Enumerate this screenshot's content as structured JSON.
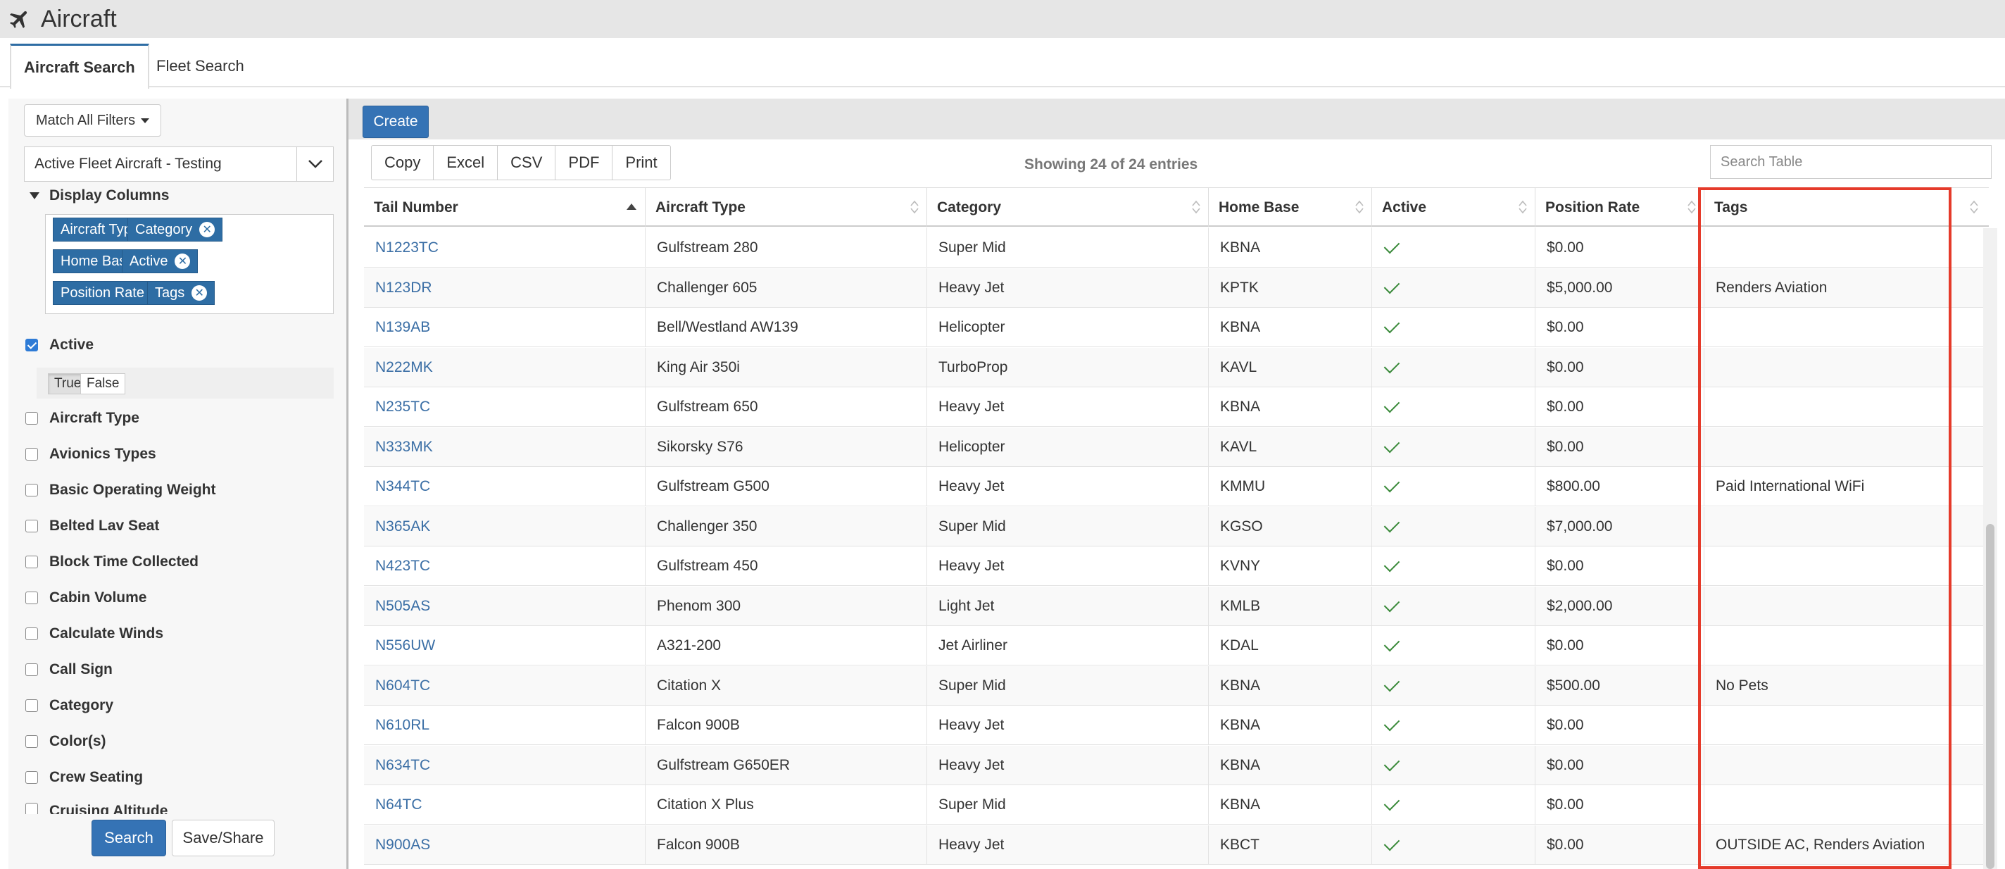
{
  "app": {
    "title": "Aircraft",
    "title_icon": "airplane-icon"
  },
  "tabs": [
    {
      "label": "Aircraft Search",
      "active": true
    },
    {
      "label": "Fleet Search",
      "active": false
    }
  ],
  "filters": {
    "match_label": "Match All Filters",
    "saved_search": "Active Fleet Aircraft - Testing",
    "display_columns_label": "Display Columns",
    "display_columns": [
      "Aircraft Type",
      "Category",
      "Home Base",
      "Active",
      "Position Rate",
      "Tags"
    ],
    "active_label": "Active",
    "active_checked": true,
    "bool_true": "True",
    "bool_false": "False",
    "options": [
      "Aircraft Type",
      "Avionics Types",
      "Basic Operating Weight",
      "Belted Lav Seat",
      "Block Time Collected",
      "Cabin Volume",
      "Calculate Winds",
      "Call Sign",
      "Category",
      "Color(s)",
      "Crew Seating",
      "Cruising Altitude"
    ],
    "search_label": "Search",
    "save_label": "Save/Share"
  },
  "main": {
    "create_label": "Create",
    "export_buttons": [
      "Copy",
      "Excel",
      "CSV",
      "PDF",
      "Print"
    ],
    "showing_text": "Showing 24 of 24 entries",
    "search_placeholder": "Search Table"
  },
  "table": {
    "headers": [
      "Tail Number",
      "Aircraft Type",
      "Category",
      "Home Base",
      "Active",
      "Position Rate",
      "Tags"
    ],
    "rows": [
      {
        "tail": "N1223TC",
        "type": "Gulfstream 280",
        "category": "Super Mid",
        "base": "KBNA",
        "active": true,
        "rate": "$0.00",
        "tags": ""
      },
      {
        "tail": "N123DR",
        "type": "Challenger 605",
        "category": "Heavy Jet",
        "base": "KPTK",
        "active": true,
        "rate": "$5,000.00",
        "tags": "Renders Aviation"
      },
      {
        "tail": "N139AB",
        "type": "Bell/Westland AW139",
        "category": "Helicopter",
        "base": "KBNA",
        "active": true,
        "rate": "$0.00",
        "tags": ""
      },
      {
        "tail": "N222MK",
        "type": "King Air 350i",
        "category": "TurboProp",
        "base": "KAVL",
        "active": true,
        "rate": "$0.00",
        "tags": ""
      },
      {
        "tail": "N235TC",
        "type": "Gulfstream 650",
        "category": "Heavy Jet",
        "base": "KBNA",
        "active": true,
        "rate": "$0.00",
        "tags": ""
      },
      {
        "tail": "N333MK",
        "type": "Sikorsky S76",
        "category": "Helicopter",
        "base": "KAVL",
        "active": true,
        "rate": "$0.00",
        "tags": ""
      },
      {
        "tail": "N344TC",
        "type": "Gulfstream G500",
        "category": "Heavy Jet",
        "base": "KMMU",
        "active": true,
        "rate": "$800.00",
        "tags": "Paid International WiFi"
      },
      {
        "tail": "N365AK",
        "type": "Challenger 350",
        "category": "Super Mid",
        "base": "KGSO",
        "active": true,
        "rate": "$7,000.00",
        "tags": ""
      },
      {
        "tail": "N423TC",
        "type": "Gulfstream 450",
        "category": "Heavy Jet",
        "base": "KVNY",
        "active": true,
        "rate": "$0.00",
        "tags": ""
      },
      {
        "tail": "N505AS",
        "type": "Phenom 300",
        "category": "Light Jet",
        "base": "KMLB",
        "active": true,
        "rate": "$2,000.00",
        "tags": ""
      },
      {
        "tail": "N556UW",
        "type": "A321-200",
        "category": "Jet Airliner",
        "base": "KDAL",
        "active": true,
        "rate": "$0.00",
        "tags": ""
      },
      {
        "tail": "N604TC",
        "type": "Citation X",
        "category": "Super Mid",
        "base": "KBNA",
        "active": true,
        "rate": "$500.00",
        "tags": "No Pets"
      },
      {
        "tail": "N610RL",
        "type": "Falcon 900B",
        "category": "Heavy Jet",
        "base": "KBNA",
        "active": true,
        "rate": "$0.00",
        "tags": ""
      },
      {
        "tail": "N634TC",
        "type": "Gulfstream G650ER",
        "category": "Heavy Jet",
        "base": "KBNA",
        "active": true,
        "rate": "$0.00",
        "tags": ""
      },
      {
        "tail": "N64TC",
        "type": "Citation X Plus",
        "category": "Super Mid",
        "base": "KBNA",
        "active": true,
        "rate": "$0.00",
        "tags": ""
      },
      {
        "tail": "N900AS",
        "type": "Falcon 900B",
        "category": "Heavy Jet",
        "base": "KBCT",
        "active": true,
        "rate": "$0.00",
        "tags": "OUTSIDE AC, Renders Aviation"
      }
    ]
  },
  "colors": {
    "accent": "#3573b5",
    "link": "#3a6ea5",
    "highlight": "#e53a2a",
    "check": "#3a8a3a"
  }
}
